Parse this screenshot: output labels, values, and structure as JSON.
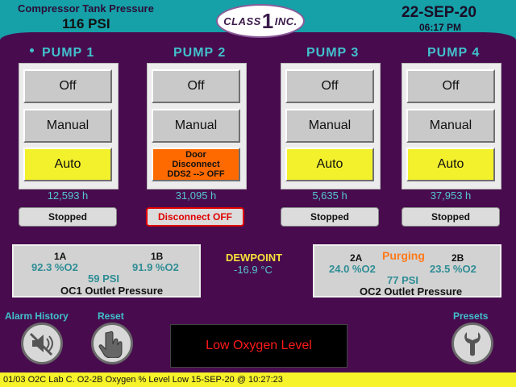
{
  "header": {
    "title": "Compressor Tank Pressure",
    "pressure": "116 PSI",
    "logo_left": "CLASS",
    "logo_num": "1",
    "logo_right": "INC.",
    "date": "22-SEP-20",
    "time": "06:17 PM"
  },
  "pumps": [
    {
      "title": "PUMP 1",
      "off": "Off",
      "manual": "Manual",
      "auto": "Auto",
      "hours": "12,593 h",
      "status": "Stopped"
    },
    {
      "title": "PUMP 2",
      "off": "Off",
      "manual": "Manual",
      "alert": [
        "Door",
        "Disconnect",
        "DDS2 --> OFF"
      ],
      "hours": "31,095 h",
      "status": "Disconnect OFF"
    },
    {
      "title": "PUMP 3",
      "off": "Off",
      "manual": "Manual",
      "auto": "Auto",
      "hours": "5,635 h",
      "status": "Stopped"
    },
    {
      "title": "PUMP 4",
      "off": "Off",
      "manual": "Manual",
      "auto": "Auto",
      "hours": "37,953 h",
      "status": "Stopped"
    }
  ],
  "oc1": {
    "a_label": "1A",
    "a_value": "92.3 %O2",
    "b_label": "1B",
    "b_value": "91.9 %O2",
    "psi": "59 PSI",
    "name": "OC1 Outlet Pressure"
  },
  "oc2": {
    "a_label": "2A",
    "a_value": "24.0 %O2",
    "b_label": "2B",
    "b_value": "23.5 %O2",
    "psi": "77 PSI",
    "name": "OC2 Outlet Pressure",
    "state": "Purging"
  },
  "dewpoint": {
    "label": "DEWPOINT",
    "value": "-16.9 °C"
  },
  "bottom": {
    "alarm_history": "Alarm History",
    "reset": "Reset",
    "presets": "Presets",
    "alarm_message": "Low Oxygen Level"
  },
  "ticker": "01/03 O2C Lab C. O2-2B Oxygen % Level Low 15-SEP-20 @ 10:27:23",
  "colors": {
    "background": "#480c4e",
    "header": "#16a0a8",
    "accent": "#41c0cc",
    "auto": "#f3f02c",
    "alert": "#ff6a00",
    "alarm_text": "#ff1a1a"
  }
}
